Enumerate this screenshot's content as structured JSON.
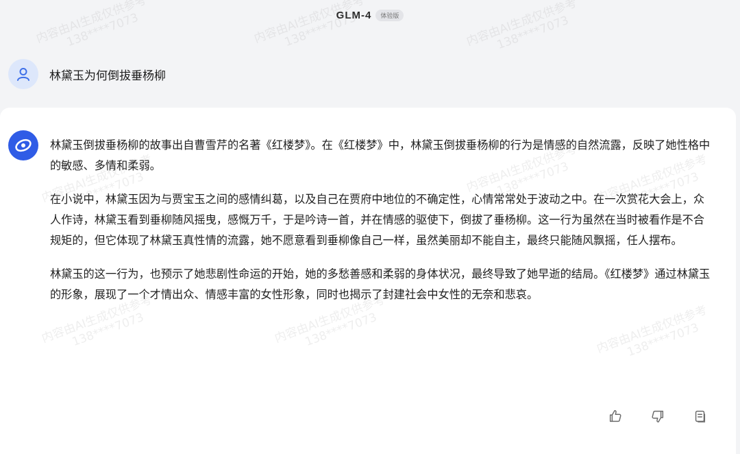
{
  "header": {
    "model_name": "GLM-4",
    "badge": "体验版"
  },
  "user": {
    "question": "林黛玉为何倒拔垂杨柳"
  },
  "answer": {
    "paragraphs": [
      "林黛玉倒拔垂杨柳的故事出自曹雪芹的名著《红楼梦》。在《红楼梦》中，林黛玉倒拔垂杨柳的行为是情感的自然流露，反映了她性格中的敏感、多情和柔弱。",
      "在小说中，林黛玉因为与贾宝玉之间的感情纠葛，以及自己在贾府中地位的不确定性，心情常常处于波动之中。在一次赏花大会上，众人作诗，林黛玉看到垂柳随风摇曳，感慨万千，于是吟诗一首，并在情感的驱使下，倒拔了垂杨柳。这一行为虽然在当时被看作是不合规矩的，但它体现了林黛玉真性情的流露，她不愿意看到垂柳像自己一样，虽然美丽却不能自主，最终只能随风飘摇，任人摆布。",
      "林黛玉的这一行为，也预示了她悲剧性命运的开始，她的多愁善感和柔弱的身体状况，最终导致了她早逝的结局。《红楼梦》通过林黛玉的形象，展现了一个才情出众、情感丰富的女性形象，同时也揭示了封建社会中女性的无奈和悲哀。"
    ]
  },
  "actions": {
    "like_icon": "thumbs-up-icon",
    "dislike_icon": "thumbs-down-icon",
    "copy_icon": "copy-icon"
  },
  "watermark": {
    "line1": "内容由AI生成仅供参考",
    "line2": "138****7073"
  },
  "colors": {
    "page_bg": "#f3f4f6",
    "card_bg": "#ffffff",
    "bot_avatar": "#2f5ce6",
    "user_avatar_bg": "#dde7fb"
  }
}
